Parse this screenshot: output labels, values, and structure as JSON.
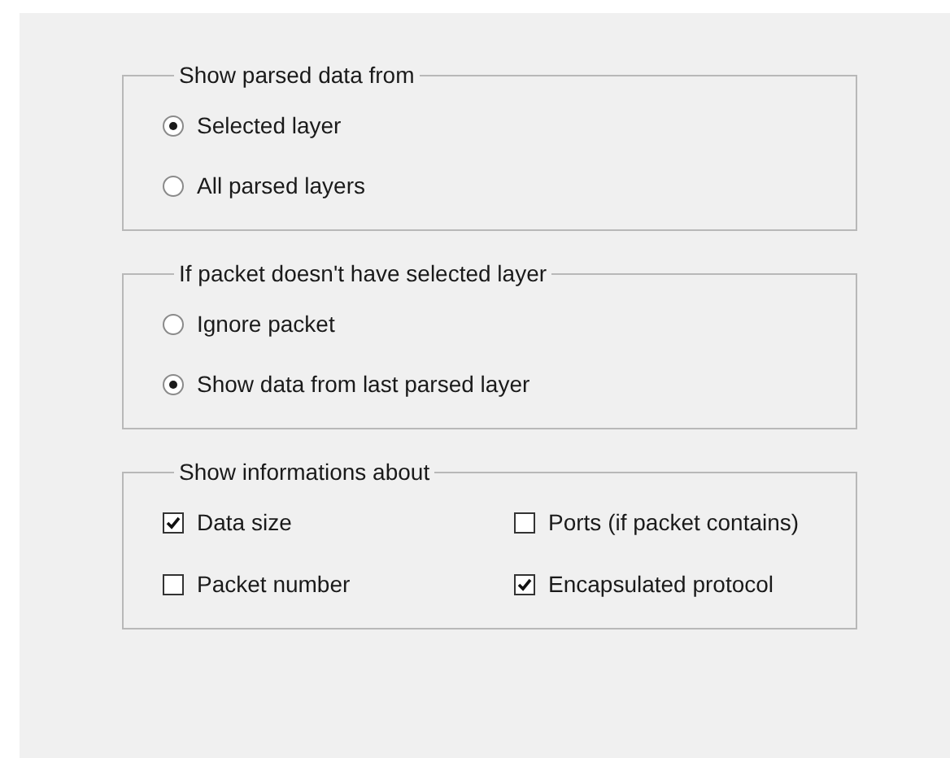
{
  "groups": [
    {
      "title": "Show parsed data from",
      "kind": "radio",
      "options": [
        {
          "label": "Selected layer",
          "selected": true
        },
        {
          "label": "All parsed layers",
          "selected": false
        }
      ]
    },
    {
      "title": "If packet doesn't have selected layer",
      "kind": "radio",
      "options": [
        {
          "label": "Ignore packet",
          "selected": false
        },
        {
          "label": "Show data from last parsed layer",
          "selected": true
        }
      ]
    },
    {
      "title": "Show informations about",
      "kind": "check",
      "options": [
        {
          "label": "Data size",
          "checked": true
        },
        {
          "label": "Ports (if packet contains)",
          "checked": false
        },
        {
          "label": "Packet number",
          "checked": false
        },
        {
          "label": "Encapsulated protocol",
          "checked": true
        }
      ]
    }
  ]
}
